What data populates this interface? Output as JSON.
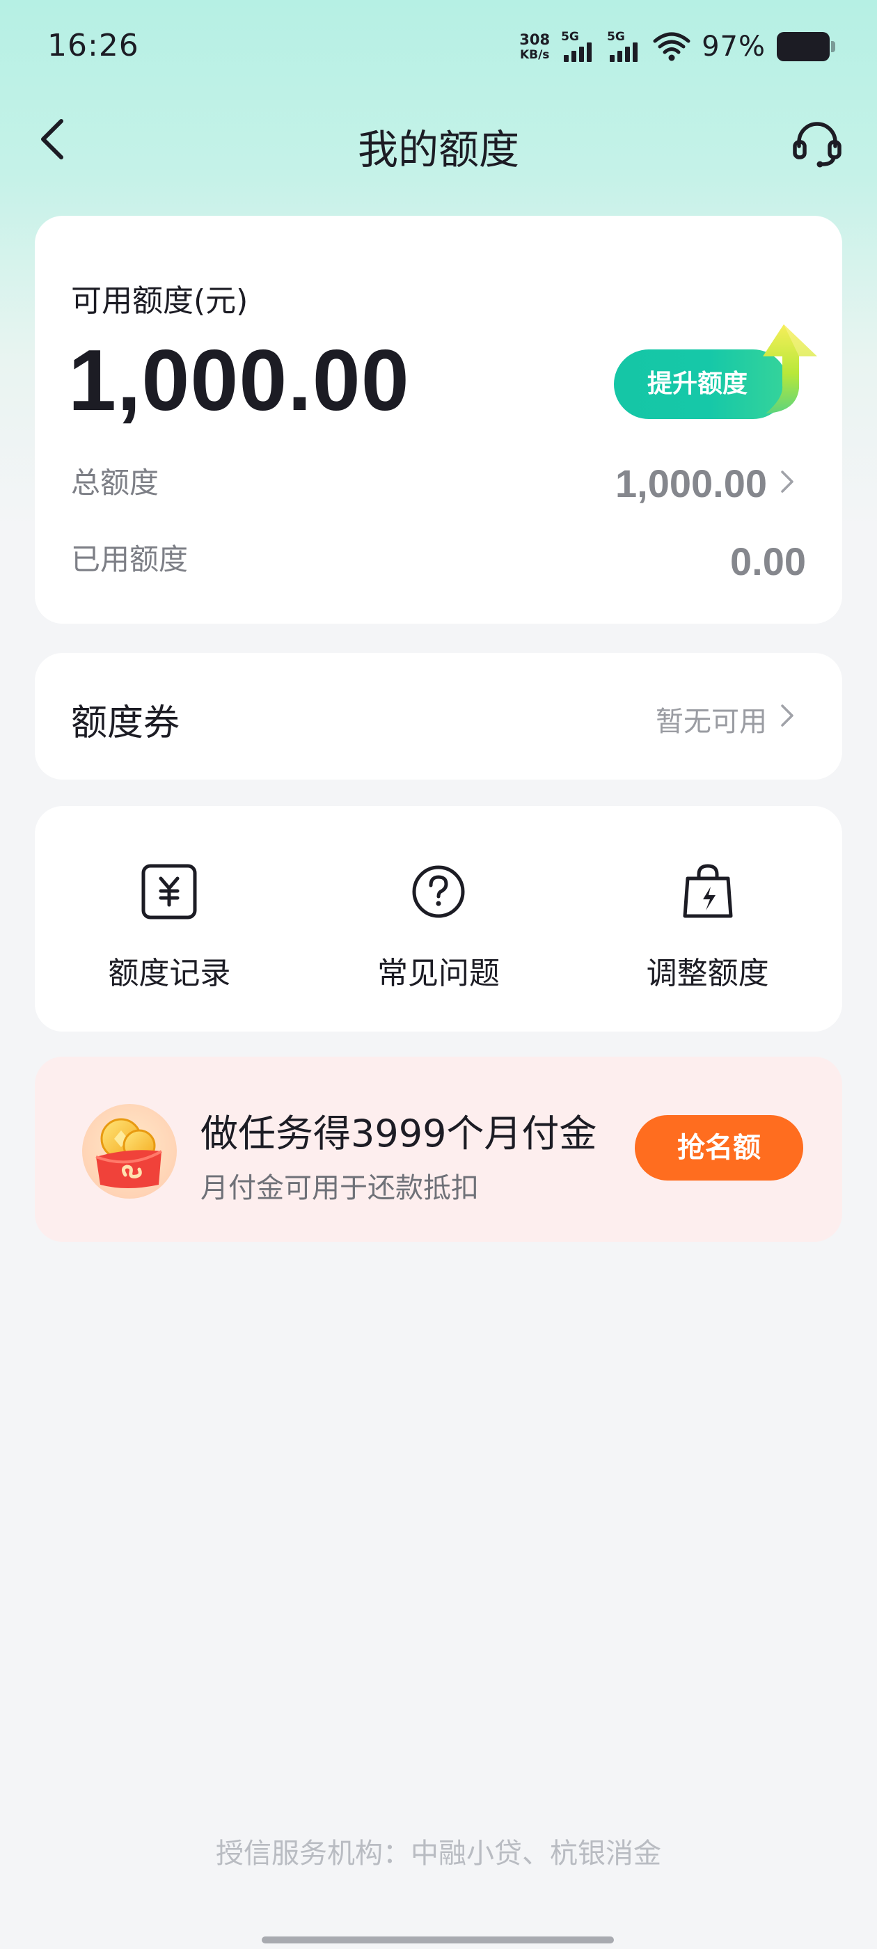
{
  "status_bar": {
    "time": "16:26",
    "net_speed_value": "308",
    "net_speed_unit": "KB/s",
    "signal_1": "5G",
    "signal_2": "5G",
    "battery_percent": "97%"
  },
  "nav": {
    "title": "我的额度",
    "back_icon": "chevron-left-icon",
    "service_icon": "headset-icon"
  },
  "quota": {
    "available_label": "可用额度(元)",
    "available_amount": "1,000.00",
    "raise_button": "提升额度",
    "total_label": "总额度",
    "total_value": "1,000.00",
    "used_label": "已用额度",
    "used_value": "0.00"
  },
  "coupon": {
    "title": "额度券",
    "status": "暂无可用"
  },
  "menu": {
    "items": [
      {
        "label": "额度记录",
        "icon": "yen-document-icon"
      },
      {
        "label": "常见问题",
        "icon": "question-circle-icon"
      },
      {
        "label": "调整额度",
        "icon": "lightning-bag-icon"
      }
    ]
  },
  "promo": {
    "title": "做任务得3999个月付金",
    "subtitle": "月付金可用于还款抵扣",
    "button": "抢名额",
    "icon": "coin-envelope-icon"
  },
  "footer": {
    "note": "授信服务机构：中融小贷、杭银消金"
  },
  "colors": {
    "accent_green": "#15c6a6",
    "promo_orange": "#ff6d1f",
    "promo_background": "#fdeeee"
  }
}
